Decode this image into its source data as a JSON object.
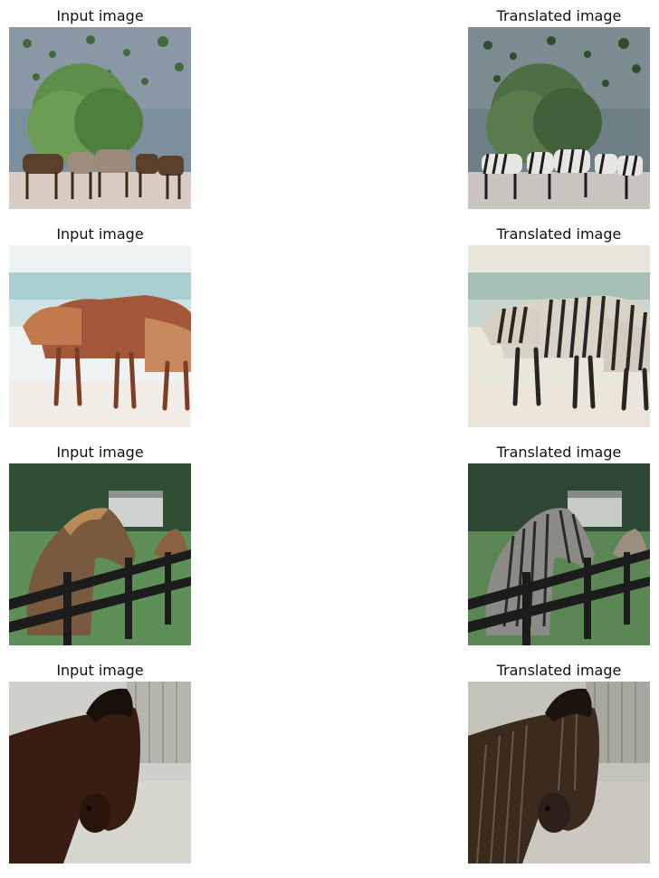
{
  "figure": {
    "rows": [
      {
        "input_title": "Input image",
        "output_title": "Translated image"
      },
      {
        "input_title": "Input image",
        "output_title": "Translated image"
      },
      {
        "input_title": "Input image",
        "output_title": "Translated image"
      },
      {
        "input_title": "Input image",
        "output_title": "Translated image"
      }
    ]
  },
  "colors": {
    "background": "#ffffff",
    "title_text": "#111111"
  }
}
